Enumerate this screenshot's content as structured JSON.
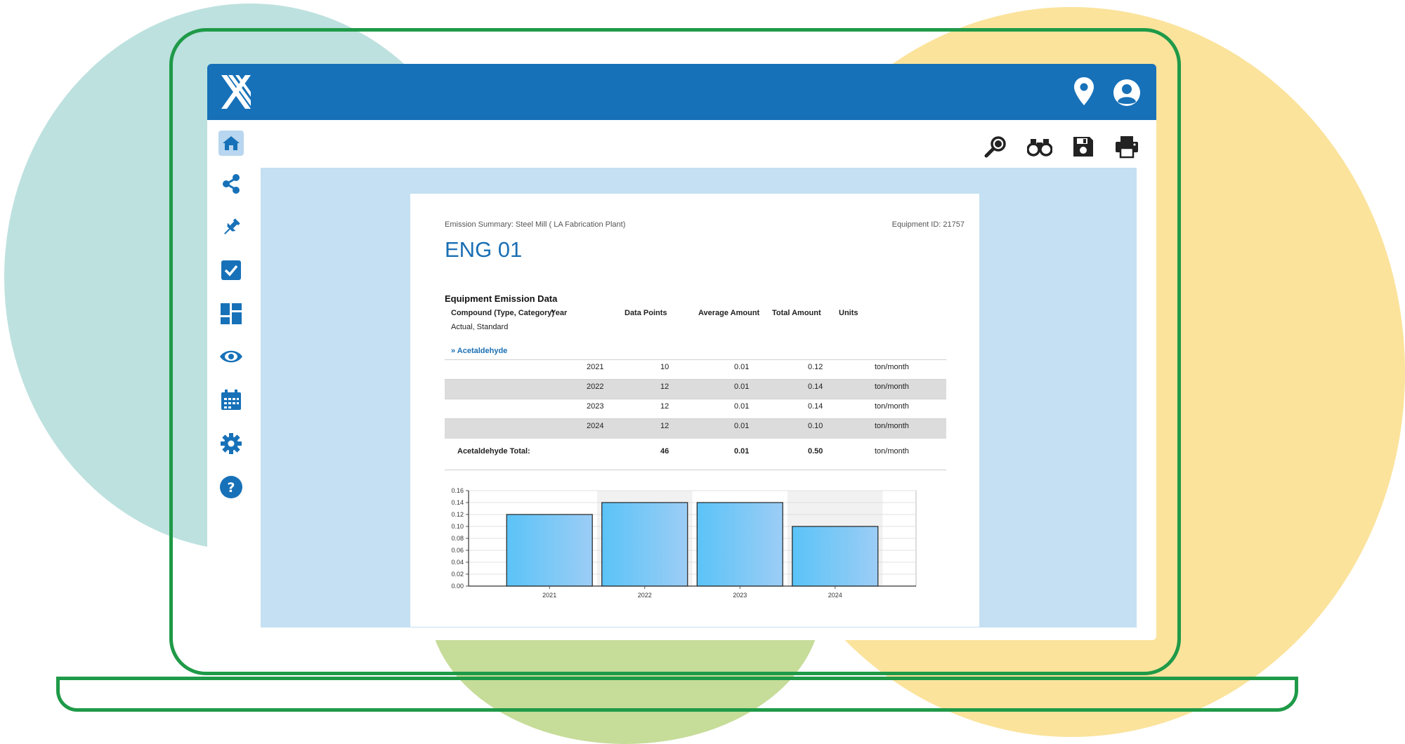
{
  "report": {
    "subtitle": "Emission Summary: Steel Mill ( LA Fabrication Plant)",
    "equipment_id": "Equipment ID: 21757",
    "title": "ENG 01",
    "section_heading": "Equipment Emission Data",
    "columns": [
      "Compound (Type, Category)",
      "Year",
      "Data Points",
      "Average Amount",
      "Total Amount",
      "Units"
    ],
    "compound_subheader": "Actual, Standard",
    "compound_link": "» Acetaldehyde",
    "rows": [
      {
        "year": "2021",
        "data_points": "10",
        "average": "0.01",
        "total": "0.12",
        "units": "ton/month"
      },
      {
        "year": "2022",
        "data_points": "12",
        "average": "0.01",
        "total": "0.14",
        "units": "ton/month"
      },
      {
        "year": "2023",
        "data_points": "12",
        "average": "0.01",
        "total": "0.14",
        "units": "ton/month"
      },
      {
        "year": "2024",
        "data_points": "12",
        "average": "0.01",
        "total": "0.10",
        "units": "ton/month"
      }
    ],
    "total_row": {
      "label": "Acetaldehyde Total:",
      "data_points": "46",
      "average": "0.01",
      "total": "0.50",
      "units": "ton/month"
    }
  },
  "sidebar": {
    "items": [
      {
        "name": "home",
        "icon": "home-icon"
      },
      {
        "name": "share",
        "icon": "share-icon"
      },
      {
        "name": "pin",
        "icon": "pushpin-icon"
      },
      {
        "name": "tasks",
        "icon": "checkbox-icon"
      },
      {
        "name": "dashboard",
        "icon": "dashboard-icon"
      },
      {
        "name": "view",
        "icon": "eye-icon"
      },
      {
        "name": "calendar",
        "icon": "calendar-icon"
      },
      {
        "name": "settings",
        "icon": "gear-icon"
      },
      {
        "name": "help",
        "icon": "help-icon"
      }
    ]
  },
  "toolbar": {
    "items": [
      "search-icon",
      "binoculars-icon",
      "save-icon",
      "print-icon"
    ]
  },
  "header": {
    "icons": [
      "location-pin-icon",
      "user-avatar-icon"
    ]
  },
  "colors": {
    "header": "#1771b8",
    "accent": "#1a6fb4",
    "preview_bg": "#c4e0f2",
    "frame": "#1f9a48",
    "bar_fill_start": "#5bc3f7",
    "bar_fill_end": "#9ccdf6"
  },
  "chart_data": {
    "type": "bar",
    "categories": [
      "2021",
      "2022",
      "2023",
      "2024"
    ],
    "values": [
      0.12,
      0.14,
      0.14,
      0.1
    ],
    "ylim": [
      0,
      0.16
    ],
    "yticks": [
      "0.00",
      "0.02",
      "0.04",
      "0.06",
      "0.08",
      "0.10",
      "0.12",
      "0.14",
      "0.16"
    ],
    "grid": true
  }
}
